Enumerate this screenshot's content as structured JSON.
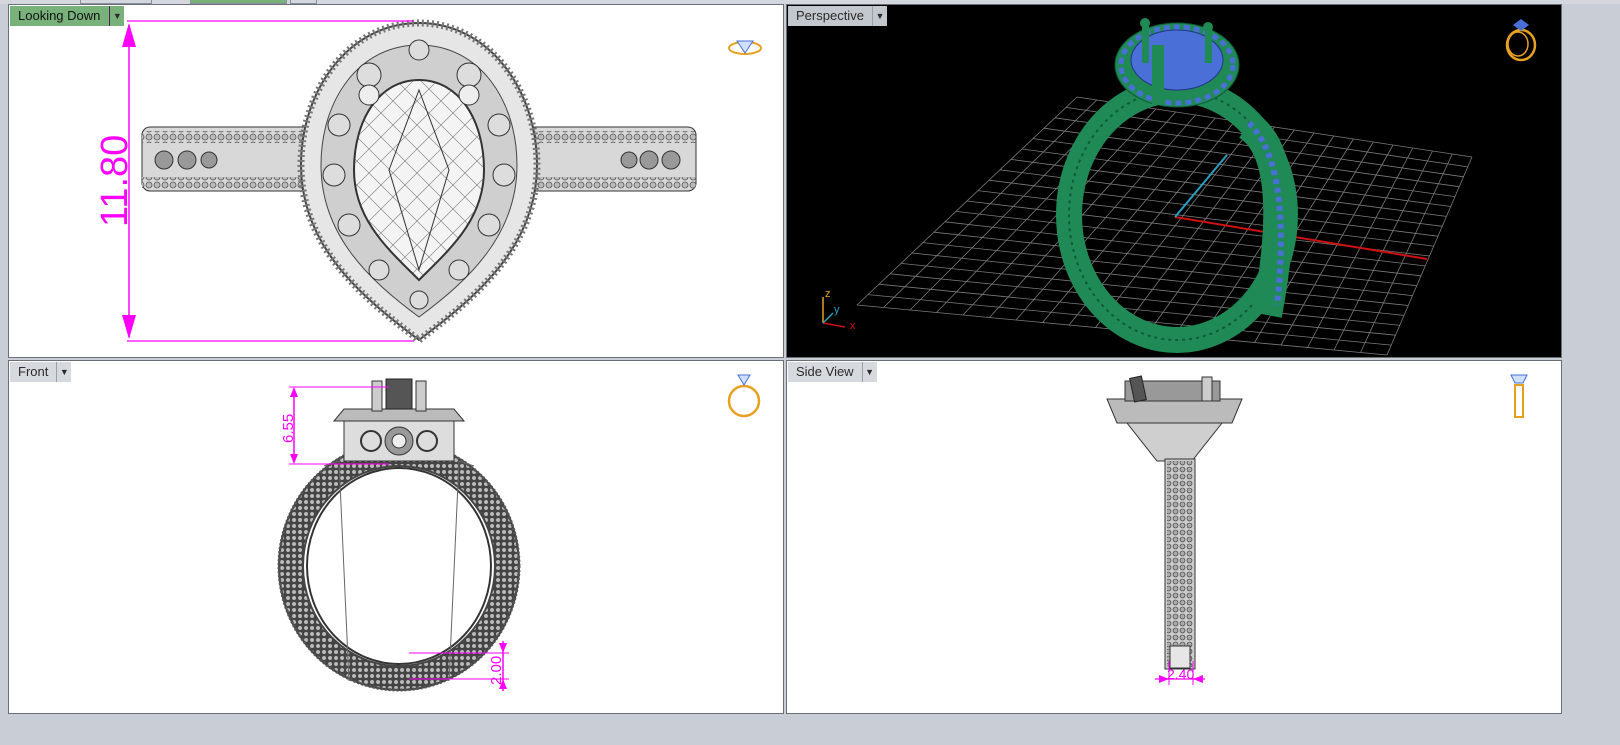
{
  "viewports": {
    "top": {
      "label": "Looking Down",
      "dimension": "11.80",
      "active": true
    },
    "perspective": {
      "label": "Perspective",
      "axes": {
        "z": "z",
        "y": "y",
        "x": "x"
      }
    },
    "front": {
      "label": "Front",
      "dimension_top": "6.55",
      "dimension_bottom": "2.00"
    },
    "side": {
      "label": "Side View",
      "dimension": "2.40"
    }
  },
  "icons": {
    "top": "ring-diamond-icon",
    "perspective": "ring-perspective-icon",
    "front": "ring-front-icon",
    "side": "ring-side-icon"
  },
  "colors": {
    "active_label": "#78b17a",
    "dimension": "#ff00ff",
    "ring_render": "#1f8a55",
    "stone": "#4a6fd6",
    "icon_gold": "#e8a020",
    "grid": "#8a8a8a",
    "x_axis": "#d01010",
    "y_axis": "#2aa0c0"
  }
}
